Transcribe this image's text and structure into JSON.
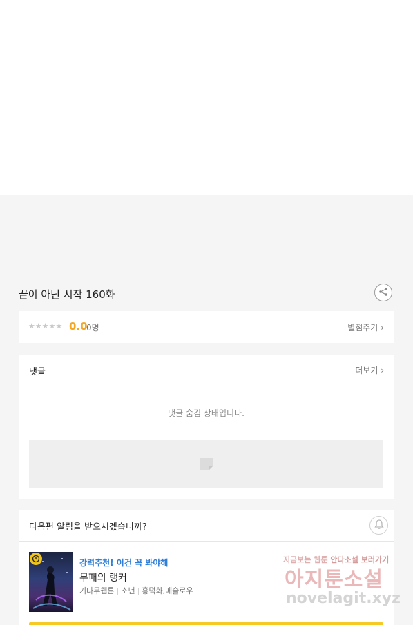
{
  "episode": {
    "title": "끝이 아닌 시작 160화"
  },
  "rating": {
    "stars": "★★★★★",
    "score": "0.0",
    "votes": "0명",
    "rate_button": "별점주기"
  },
  "comments": {
    "title": "댓글",
    "more_button": "더보기",
    "hidden_message": "댓글 숨김 상태입니다."
  },
  "alert": {
    "title": "다음편 알림을 받으시겠습니까?"
  },
  "recommendation": {
    "promo": "강력추천! 이건 꼭 봐야해",
    "title": "무패의 랭커",
    "genre": "기다무웹툰",
    "category": "소년",
    "authors": "홍덕화,메슬로우"
  },
  "watermark": {
    "line1_a": "지금보는 웹툰",
    "line1_b": "안다소설 보러가기",
    "line2": "아지툰소설",
    "line3": "novelagit.xyz"
  },
  "colors": {
    "accent_yellow": "#f6c925",
    "score_orange": "#f5a623",
    "promo_blue": "#2f7fd9"
  }
}
